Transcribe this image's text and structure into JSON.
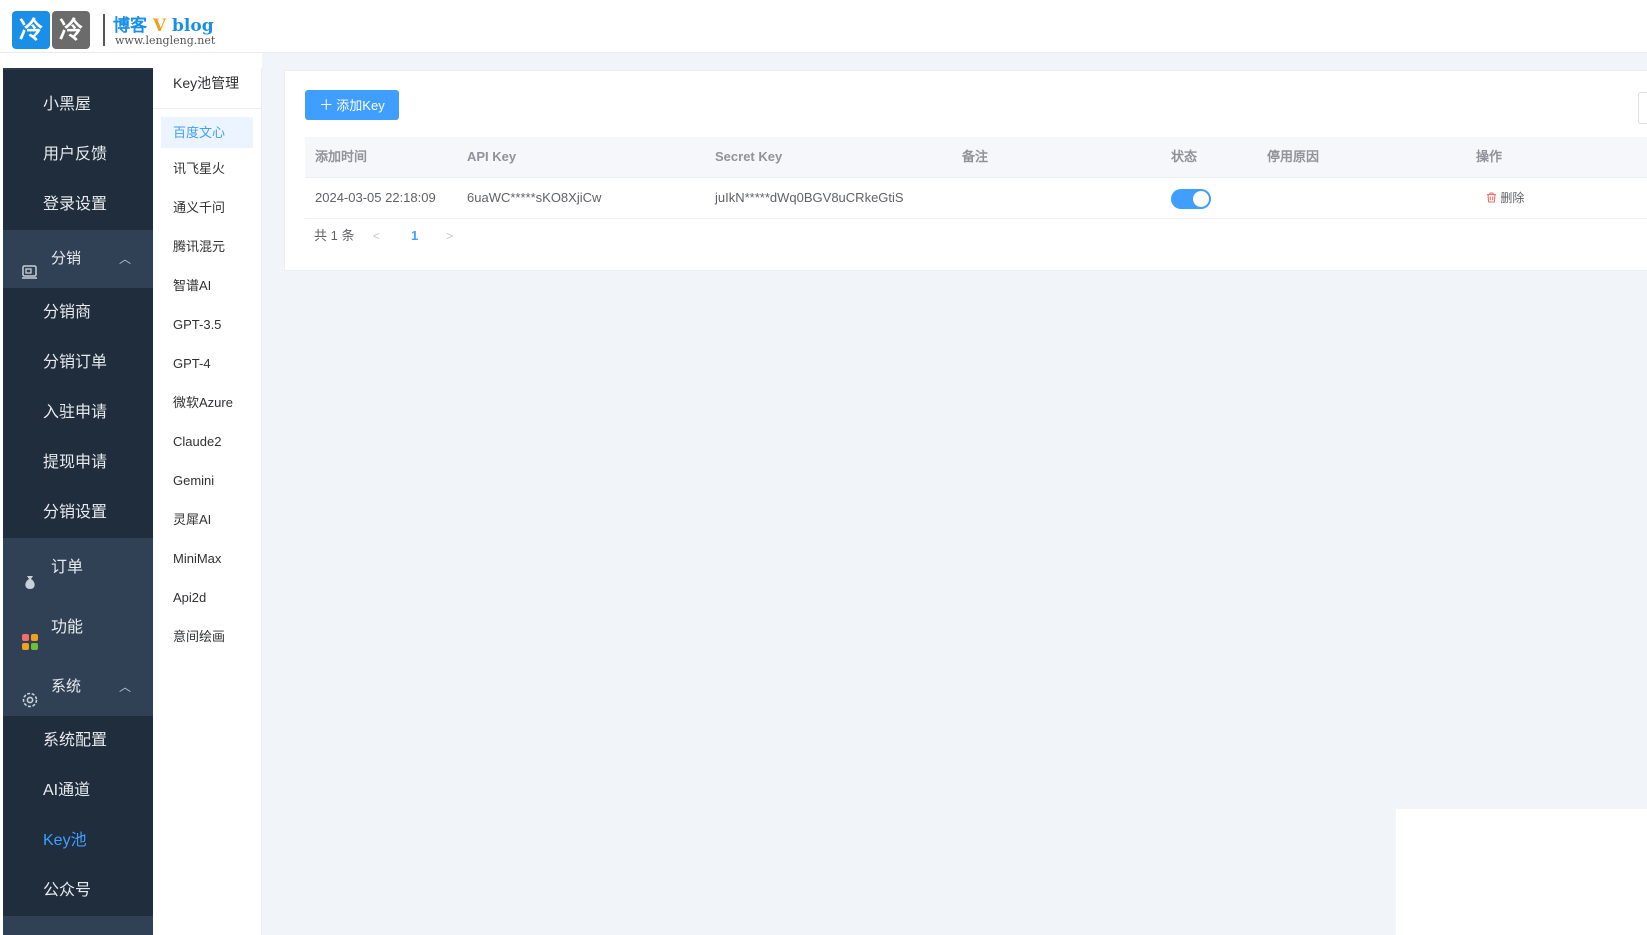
{
  "header": {
    "logo_char_1": "冷",
    "logo_char_2": "冷",
    "site_title_a": "博客",
    "site_title_v": "V",
    "site_title_b": "blog",
    "site_url": "www.lengleng.net"
  },
  "nav": {
    "items_top": [
      "小黑屋",
      "用户反馈",
      "登录设置"
    ],
    "group_fenxiao": "分销",
    "items_fenxiao": [
      "分销商",
      "分销订单",
      "入驻申请",
      "提现申请",
      "分销设置"
    ],
    "group_order": "订单",
    "group_func": "功能",
    "group_system": "系统",
    "items_system": [
      "系统配置",
      "AI通道",
      "Key池",
      "公众号"
    ]
  },
  "subnav": {
    "title": "Key池管理",
    "items": [
      "百度文心",
      "讯飞星火",
      "通义千问",
      "腾讯混元",
      "智谱AI",
      "GPT-3.5",
      "GPT-4",
      "微软Azure",
      "Claude2",
      "Gemini",
      "灵犀AI",
      "MiniMax",
      "Api2d",
      "意间绘画"
    ]
  },
  "main": {
    "add_button": "添加Key",
    "columns": [
      "添加时间",
      "API Key",
      "Secret Key",
      "备注",
      "状态",
      "停用原因",
      "操作"
    ],
    "rows": [
      {
        "time": "2024-03-05 22:18:09",
        "api_key": "6uaWC*****sKO8XjiCw",
        "secret_key": "juIkN*****dWq0BGV8uCRkeGtiS",
        "remark": "",
        "status_on": true,
        "reason": "",
        "action": "删除"
      }
    ],
    "pagination": {
      "total_text": "共 1 条",
      "current_page": "1"
    }
  },
  "colors": {
    "accent": "#409eff",
    "nav_bg": "#1f2d3d",
    "nav_group_bg": "#304156",
    "danger": "#f56c6c"
  }
}
